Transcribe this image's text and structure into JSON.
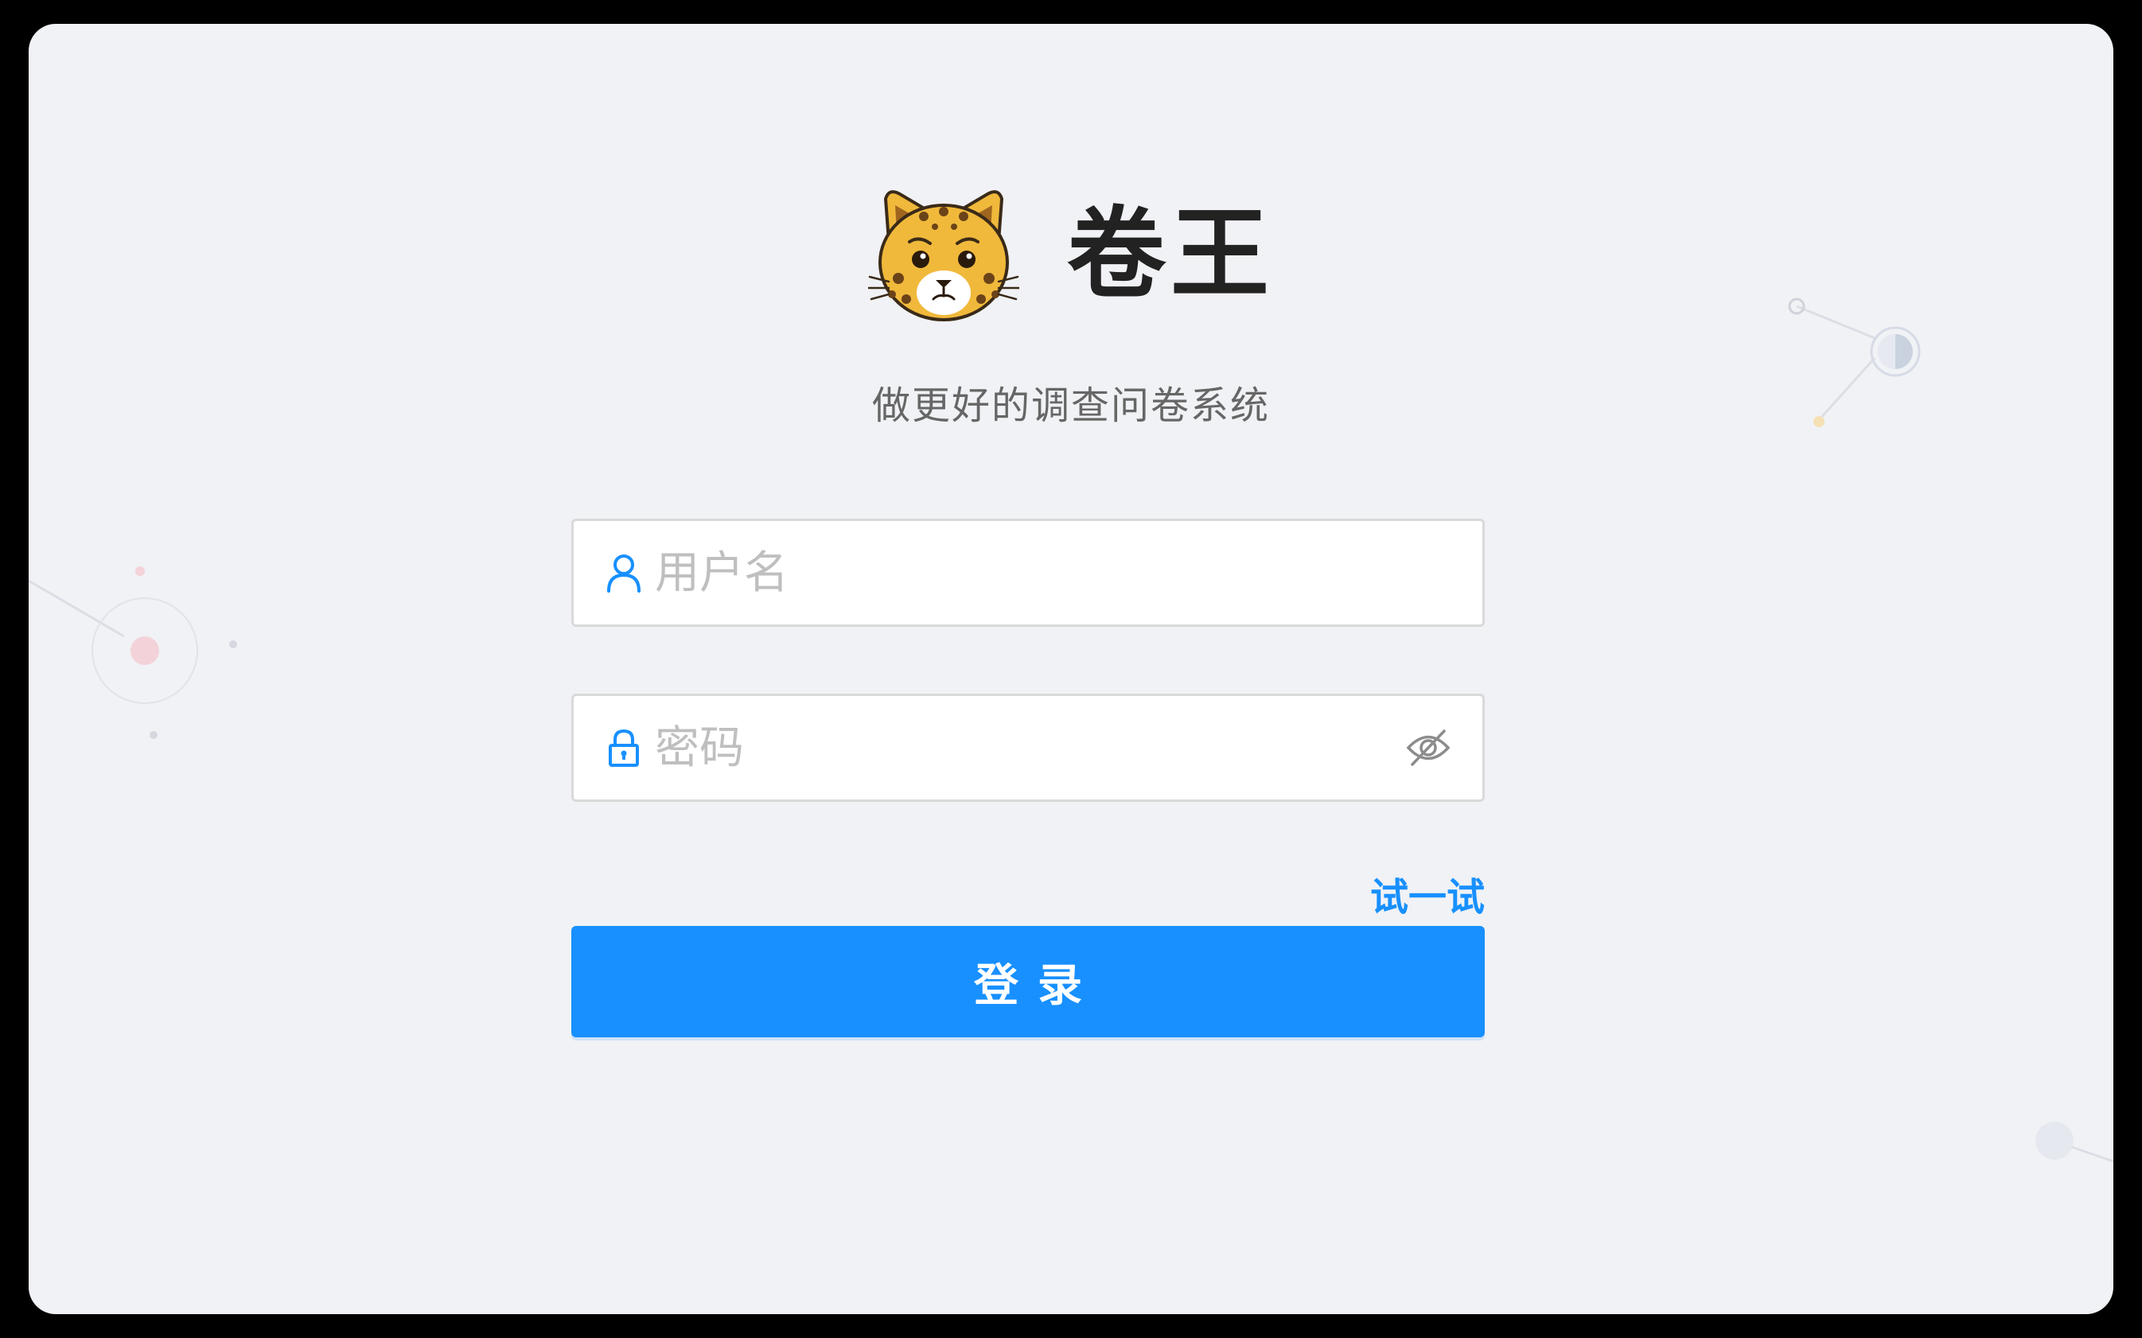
{
  "app": {
    "title": "卷王",
    "slogan": "做更好的调查问卷系统",
    "logo_icon": "leopard-face-logo"
  },
  "login_form": {
    "username": {
      "placeholder": "用户名",
      "value": "",
      "icon": "user-icon"
    },
    "password": {
      "placeholder": "密码",
      "value": "",
      "icon": "lock-icon",
      "toggle_icon": "eye-slash-icon"
    },
    "try_link_label": "试一试",
    "submit_label": "登录"
  },
  "colors": {
    "background": "#f0f2f5",
    "primary": "#1890ff",
    "title_text": "#222222",
    "slogan_text": "#666666",
    "placeholder": "#bfbfbf",
    "input_border": "#d9d9d9"
  }
}
